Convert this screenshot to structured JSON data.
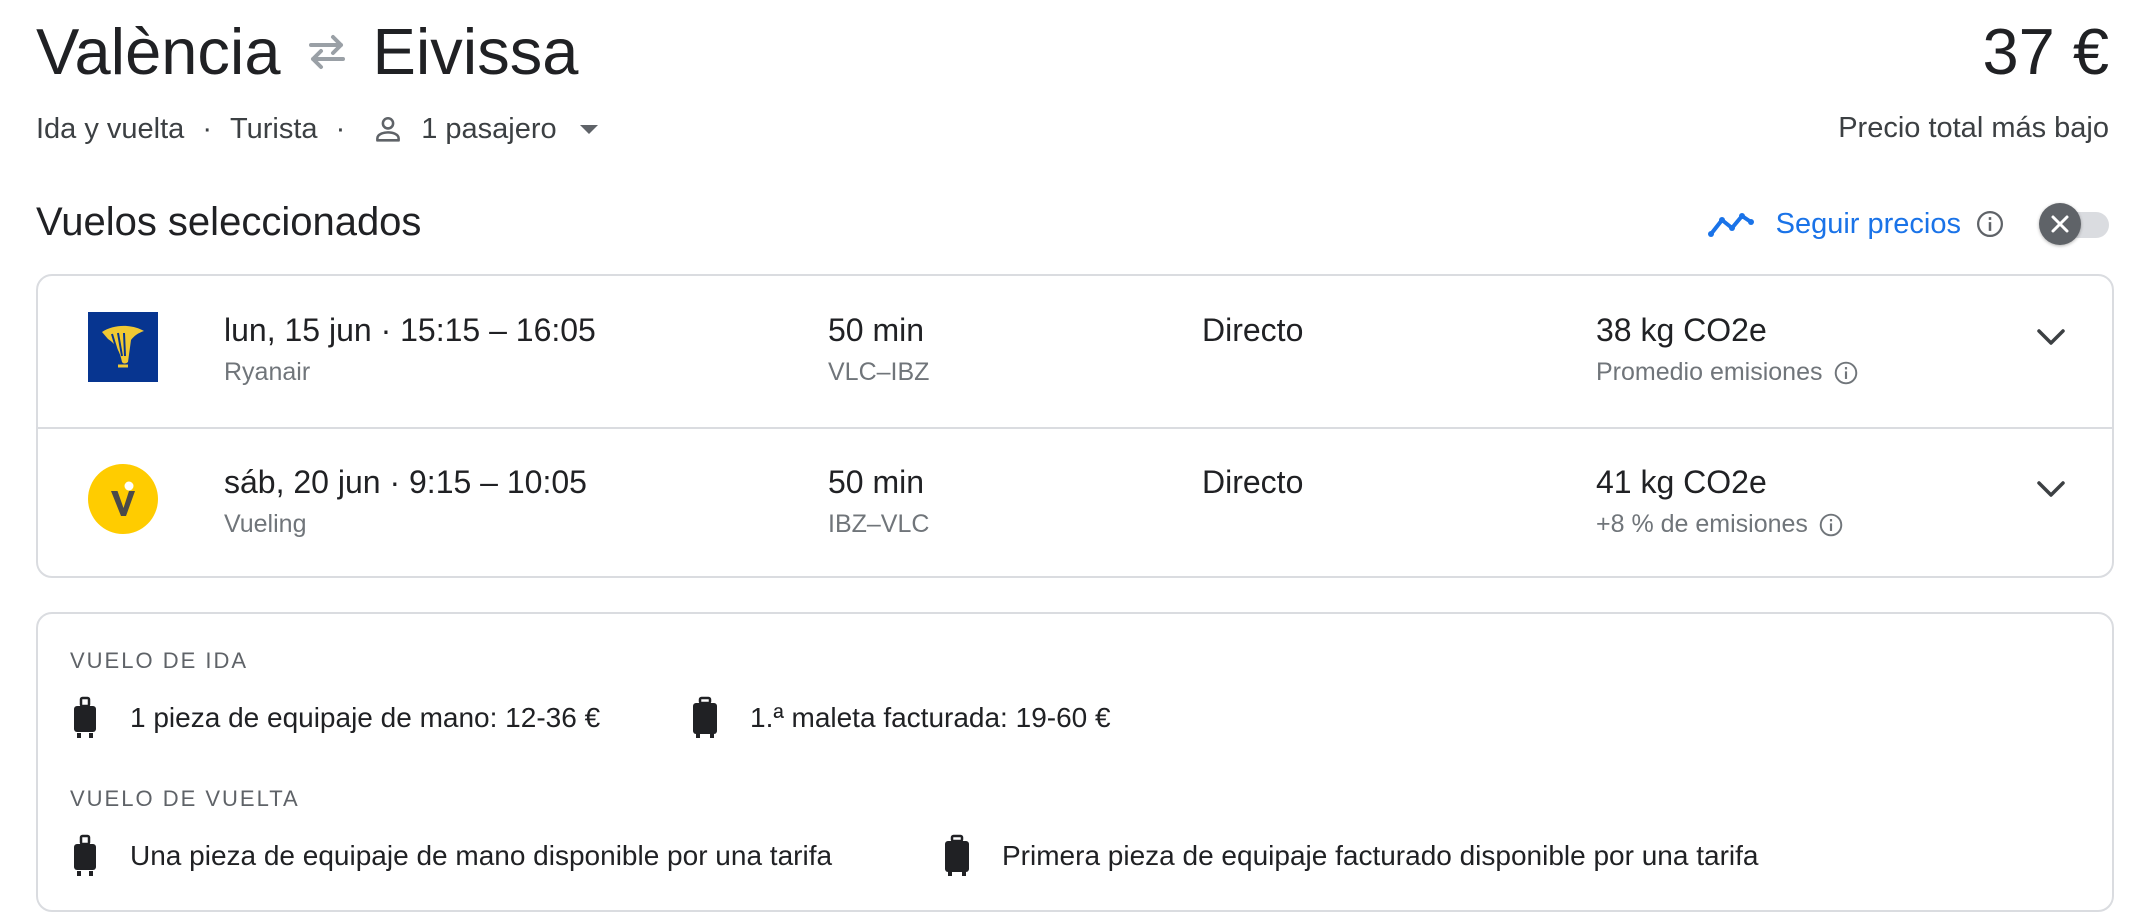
{
  "header": {
    "origin": "València",
    "destination": "Eivissa",
    "trip_type": "Ida y vuelta",
    "cabin": "Turista",
    "passengers": "1 pasajero",
    "price": "37 €",
    "price_label": "Precio total más bajo"
  },
  "selected": {
    "title": "Vuelos seleccionados",
    "track_label": "Seguir precios",
    "track_enabled": false
  },
  "flights": [
    {
      "date": "lun, 15 jun",
      "times": "15:15 – 16:05",
      "airline": "Ryanair",
      "duration": "50 min",
      "route": "VLC–IBZ",
      "stops": "Directo",
      "emissions": "38 kg CO2e",
      "emissions_note": "Promedio emisiones",
      "logo_color": "#073590"
    },
    {
      "date": "sáb, 20 jun",
      "times": "9:15 – 10:05",
      "airline": "Vueling",
      "duration": "50 min",
      "route": "IBZ–VLC",
      "stops": "Directo",
      "emissions": "41 kg CO2e",
      "emissions_note": "+8 % de emisiones",
      "logo_color": "#ffcc00"
    }
  ],
  "baggage": {
    "outbound_title": "VUELO DE IDA",
    "outbound_carry_on": "1 pieza de equipaje de mano: 12-36 €",
    "outbound_checked": "1.ª maleta facturada: 19-60 €",
    "return_title": "VUELO DE VUELTA",
    "return_carry_on": "Una pieza de equipaje de mano disponible por una tarifa",
    "return_checked": "Primera pieza de equipaje facturado disponible por una tarifa"
  },
  "icons": {
    "swap": "swap-arrows-icon",
    "passenger": "person-icon",
    "dropdown": "caret-down-icon",
    "track": "trending-line-icon",
    "info": "info-icon",
    "toggle_knob": "close-icon",
    "expand": "chevron-down-icon",
    "carry_on": "carry-on-bag-icon",
    "checked_bag": "checked-bag-icon"
  },
  "colors": {
    "accent": "#1a73e8",
    "text": "#202124",
    "muted": "#70757a",
    "border": "#dadce0"
  }
}
